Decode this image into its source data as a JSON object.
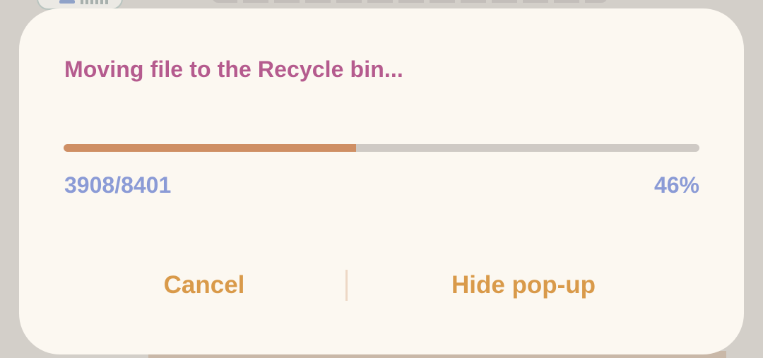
{
  "dialog": {
    "title": "Moving file to the Recycle bin...",
    "progress": {
      "fraction": 0.46,
      "count_label": "3908/8401",
      "percent_label": "46%"
    },
    "buttons": {
      "cancel_label": "Cancel",
      "hide_label": "Hide pop-up"
    }
  },
  "colors": {
    "dialog_background": "#fcf8f1",
    "title": "#b55b8e",
    "progress_fill": "#cf8f64",
    "progress_track": "#cfcac5",
    "counter_text": "#8b9bd6",
    "button_text": "#d99a4a",
    "scrim": "#d3cfc9"
  }
}
